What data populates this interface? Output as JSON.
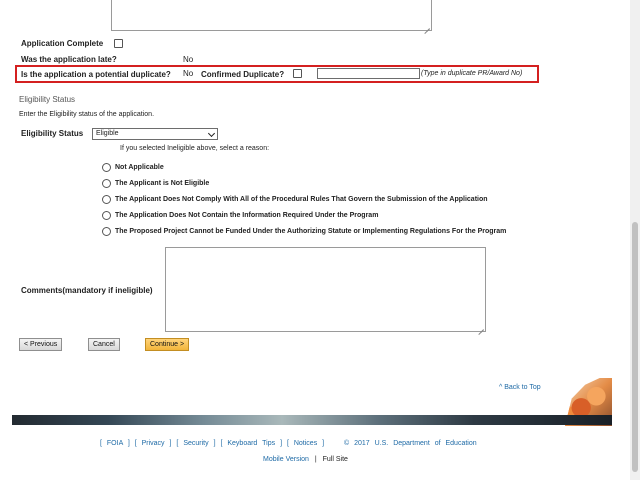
{
  "application": {
    "complete_label": "Application Complete",
    "late_label": "Was the application late?",
    "late_value": "No"
  },
  "duplicate": {
    "question_label": "Is the application a potential duplicate?",
    "question_value": "No",
    "confirmed_label": "Confirmed Duplicate?",
    "hint": "(Type in duplicate PR/Award No)"
  },
  "eligibility": {
    "section_title": "Eligibility Status",
    "instruction": "Enter the Eligibility status of the application.",
    "field_label": "Eligibility Status",
    "selected_value": "Eligible",
    "reason_prompt": "If you selected Ineligible above, select a reason:",
    "reasons": [
      "Not Applicable",
      "The Applicant is Not Eligible",
      "The Applicant Does Not Comply With All of the Procedural Rules That Govern the Submission of the Application",
      "The Application Does Not Contain the Information Required Under the Program",
      "The Proposed Project Cannot be Funded Under the Authorizing Statute or Implementing Regulations For the Program"
    ],
    "comments_label": "Comments(mandatory if ineligible)"
  },
  "buttons": {
    "previous": "< Previous",
    "cancel": "Cancel",
    "continue": "Continue >"
  },
  "footer": {
    "back_to_top": "^ Back to Top",
    "links": [
      "FOIA",
      "Privacy",
      "Security",
      "Keyboard Tips",
      "Notices"
    ],
    "copyright": "© 2017 U.S. Department of Education",
    "mobile_version": "Mobile Version",
    "separator": "|",
    "full_site": "Full Site"
  },
  "icons": {
    "checkbox": "checkbox-icon",
    "radio": "radio-icon",
    "dropdown": "chevron-down-icon"
  },
  "colors": {
    "highlight_border": "#d42020",
    "link": "#1e6aa6",
    "primary_button": "#f2b53b"
  }
}
